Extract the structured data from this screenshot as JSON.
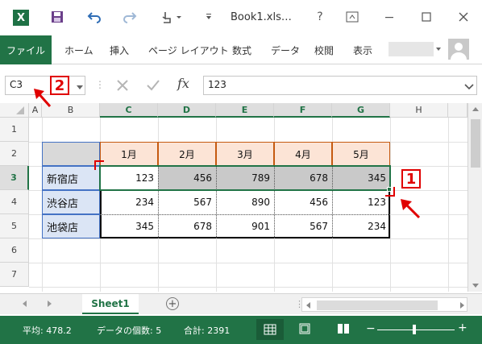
{
  "titlebar": {
    "doc_title": "Book1.xls…",
    "help": "?",
    "app_icon_letter": "X"
  },
  "ribbon": {
    "tabs": [
      "ファイル",
      "ホーム",
      "挿入",
      "ページ レイアウト",
      "数式",
      "データ",
      "校閲",
      "表示"
    ]
  },
  "formula_bar": {
    "name_box": "C3",
    "fx": "fx",
    "value": "123"
  },
  "sheet": {
    "columns": [
      "A",
      "B",
      "C",
      "D",
      "E",
      "F",
      "G",
      "H"
    ],
    "rows": [
      "1",
      "2",
      "3",
      "4",
      "5",
      "6",
      "7"
    ],
    "month_headers": [
      "1月",
      "2月",
      "3月",
      "4月",
      "5月"
    ],
    "stores": [
      {
        "name": "新宿店",
        "values": [
          "123",
          "456",
          "789",
          "678",
          "345"
        ]
      },
      {
        "name": "渋谷店",
        "values": [
          "234",
          "567",
          "890",
          "456",
          "123"
        ]
      },
      {
        "name": "池袋店",
        "values": [
          "345",
          "678",
          "901",
          "567",
          "234"
        ]
      }
    ]
  },
  "sheet_tabs": {
    "active": "Sheet1",
    "add_label": "+"
  },
  "status_bar": {
    "average": "平均: 478.2",
    "count": "データの個数: 5",
    "sum": "合計: 2391"
  },
  "annotations": {
    "badge1": "1",
    "badge2": "2"
  },
  "colors": {
    "accent": "#217346",
    "header_fill": "#fce4d6",
    "store_fill": "#dbe5f5",
    "selection_fill": "#c9c9c9",
    "annotation": "#e00000"
  }
}
